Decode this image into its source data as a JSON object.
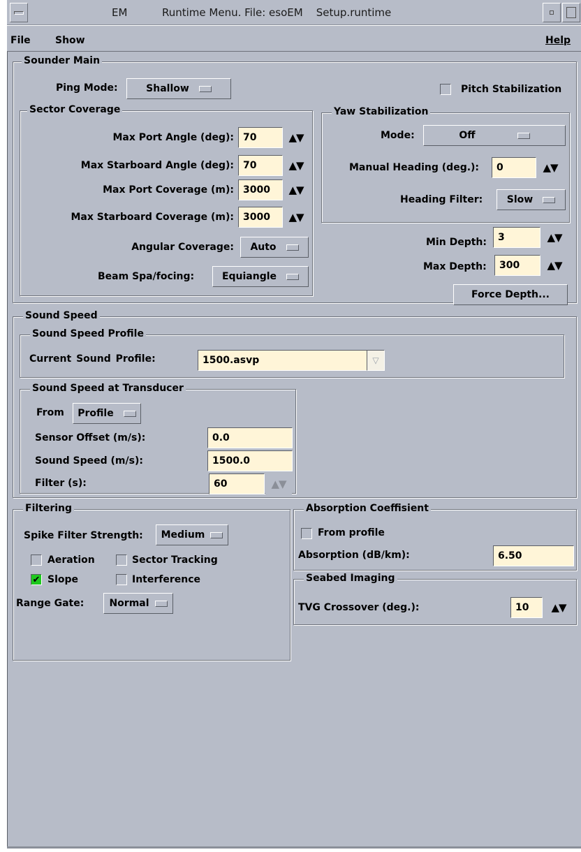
{
  "window": {
    "title_app": "EM",
    "title_text": "Runtime Menu. File: esoEM    Setup.runtime"
  },
  "menubar": {
    "file": "File",
    "show": "Show",
    "help": "Help"
  },
  "sounder_main": {
    "title": "Sounder Main",
    "ping_mode_label": "Ping Mode:",
    "ping_mode_value": "Shallow",
    "pitch_stabilization_label": "Pitch Stabilization",
    "pitch_stabilization_checked": false,
    "sector_coverage": {
      "title": "Sector Coverage",
      "max_port_angle_label": "Max Port Angle (deg):",
      "max_port_angle_value": "70",
      "max_starboard_angle_label": "Max Starboard Angle (deg):",
      "max_starboard_angle_value": "70",
      "max_port_coverage_label": "Max Port Coverage (m):",
      "max_port_coverage_value": "3000",
      "max_starboard_coverage_label": "Max Starboard Coverage (m):",
      "max_starboard_coverage_value": "3000",
      "angular_coverage_label": "Angular Coverage:",
      "angular_coverage_value": "Auto",
      "beam_spacing_label": "Beam Spa/focing:",
      "beam_spacing_value": "Equiangle"
    },
    "yaw_stabilization": {
      "title": "Yaw Stabilization",
      "mode_label": "Mode:",
      "mode_value": "Off",
      "manual_heading_label": "Manual Heading (deg.):",
      "manual_heading_value": "0",
      "heading_filter_label": "Heading Filter:",
      "heading_filter_value": "Slow"
    },
    "min_depth_label": "Min Depth:",
    "min_depth_value": "3",
    "max_depth_label": "Max Depth:",
    "max_depth_value": "300",
    "force_depth_label": "Force Depth..."
  },
  "sound_speed": {
    "title": "Sound Speed",
    "profile_group_title": "Sound Speed Profile",
    "current_profile_label": "Current  Sound  Profile:",
    "current_profile_value": "1500.asvp",
    "transducer_group_title": "Sound Speed at Transducer",
    "from_label": "From",
    "from_value": "Profile",
    "sensor_offset_label": "Sensor Offset (m/s):",
    "sensor_offset_value": "0.0",
    "sound_speed_label": "Sound Speed (m/s):",
    "sound_speed_value": "1500.0",
    "filter_label": "Filter (s):",
    "filter_value": "60"
  },
  "filtering": {
    "title": "Filtering",
    "spike_filter_label": "Spike Filter Strength:",
    "spike_filter_value": "Medium",
    "aeration_label": "Aeration",
    "aeration_checked": false,
    "sector_tracking_label": "Sector Tracking",
    "sector_tracking_checked": false,
    "slope_label": "Slope",
    "slope_checked": true,
    "interference_label": "Interference",
    "interference_checked": false,
    "range_gate_label": "Range Gate:",
    "range_gate_value": "Normal"
  },
  "absorption": {
    "title": "Absorption Coeffisient",
    "from_profile_label": "From profile",
    "from_profile_checked": false,
    "absorption_label": "Absorption (dB/km):",
    "absorption_value": "6.50"
  },
  "seabed_imaging": {
    "title": "Seabed Imaging",
    "tvg_crossover_label": "TVG Crossover (deg.):",
    "tvg_crossover_value": "10"
  },
  "icons": {
    "spin": "▲▼",
    "check": "✔",
    "combo_arrow": "▽"
  }
}
